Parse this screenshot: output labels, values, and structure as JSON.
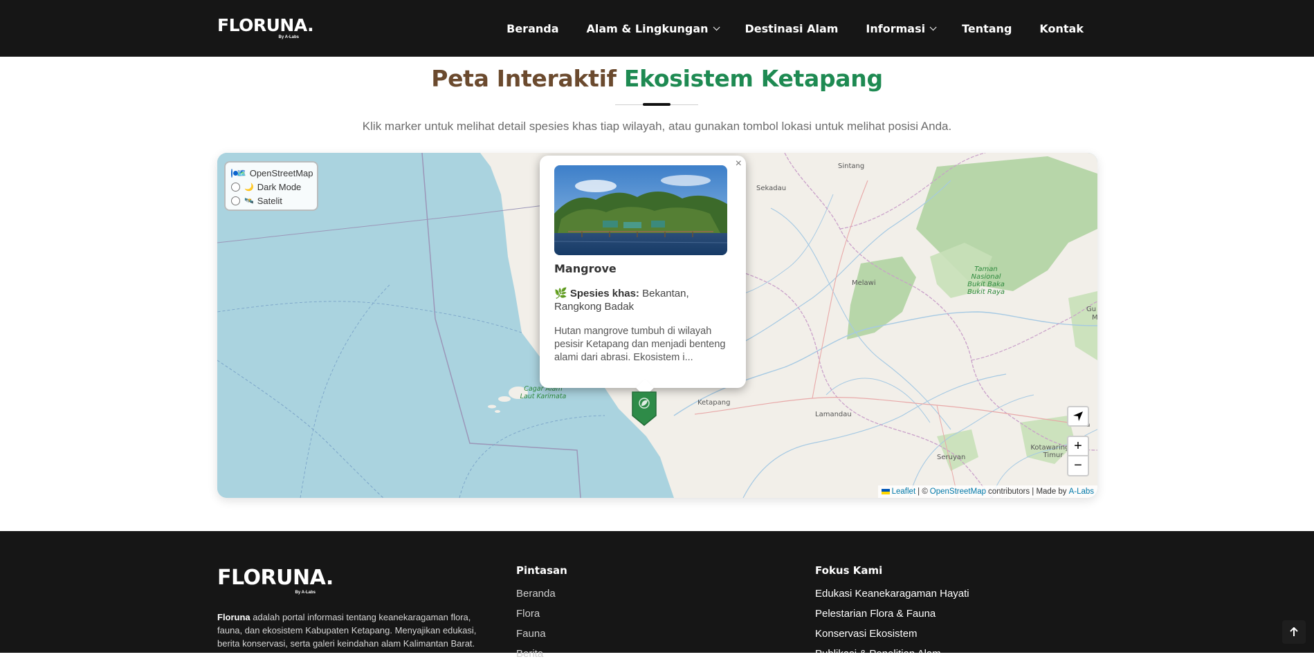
{
  "nav": {
    "logo": "FLORUNA.",
    "logo_sub": "By A-Labs",
    "items": [
      "Beranda",
      "Alam & Lingkungan",
      "Destinasi Alam",
      "Informasi",
      "Tentang",
      "Kontak"
    ]
  },
  "heading": {
    "title_part1": "Peta Interaktif",
    "title_part2": "Ekosistem Ketapang",
    "subtitle": "Klik marker untuk melihat detail spesies khas tiap wilayah, atau gunakan tombol lokasi untuk melihat posisi Anda."
  },
  "map": {
    "layers": [
      {
        "icon": "🗺️",
        "label": "OpenStreetMap",
        "selected": true
      },
      {
        "icon": "🌙",
        "label": "Dark Mode",
        "selected": false
      },
      {
        "icon": "🛰️",
        "label": "Satelit",
        "selected": false
      }
    ],
    "places": [
      "Sintang",
      "Sekadau",
      "Melawi",
      "Ketapang",
      "Lamandau",
      "Seruyan",
      "Kotawaringin Timur",
      "Gu",
      "M",
      "Ka"
    ],
    "park_label": "Taman Nasional Bukit Baka Bukit Raya",
    "marine_label": "Cagar Alam Laut Karimata",
    "popup": {
      "title": "Mangrove",
      "species_icon": "🌿",
      "species_label": "Spesies khas:",
      "species": "Bekantan, Rangkong Badak",
      "description": "Hutan mangrove tumbuh di wilayah pesisir Ketapang dan menjadi benteng alami dari abrasi. Ekosistem i...",
      "close": "×"
    },
    "controls": {
      "zoom_in": "+",
      "zoom_out": "−"
    },
    "attribution": {
      "leaflet": "Leaflet",
      "sep1": "| ©",
      "osm": "OpenStreetMap",
      "contrib": "contributors | Made by",
      "alabs": "A-Labs"
    }
  },
  "footer": {
    "logo": "FLORUNA.",
    "logo_sub": "By A-Labs",
    "about_brand": "Floruna",
    "about_text": "adalah portal informasi tentang keanekaragaman flora, fauna, dan ekosistem Kabupaten Ketapang. Menyajikan edukasi, berita konservasi, serta galeri keindahan alam Kalimantan Barat.",
    "shortcuts_title": "Pintasan",
    "shortcuts": [
      "Beranda",
      "Flora",
      "Fauna",
      "Berita"
    ],
    "focus_title": "Fokus Kami",
    "focus": [
      "Edukasi Keanekaragaman Hayati",
      "Pelestarian Flora & Fauna",
      "Konservasi Ekosistem",
      "Publikasi & Penelitian Alam"
    ]
  },
  "colors": {
    "dark": "#161616",
    "brown": "#6b4a2e",
    "green": "#1e8a52",
    "water": "#aad3df",
    "land": "#f2efe9",
    "forest": "#add19e"
  }
}
